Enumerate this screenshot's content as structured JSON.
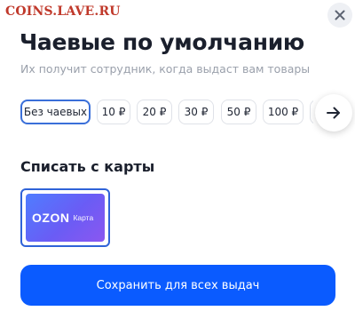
{
  "watermark": "COINS.LAVE.RU",
  "modal": {
    "title": "Чаевые по умолчанию",
    "subtitle": "Их получит сотрудник, когда выдаст вам товары"
  },
  "tips": {
    "options": [
      "Без чаевых",
      "10 ₽",
      "20 ₽",
      "30 ₽",
      "50 ₽",
      "100 ₽"
    ],
    "selected": "Без чаевых"
  },
  "payment": {
    "section_title": "Списать с карты",
    "card_brand": "OZON",
    "card_label": "Карта"
  },
  "save_button": "Сохранить для всех выдач",
  "colors": {
    "accent": "#0a5bff",
    "selected_border": "#3a6fd9",
    "card_gradient_start": "#4f7dff",
    "card_gradient_end": "#8b57f0"
  },
  "icons": {
    "close": "close-icon",
    "next": "arrow-right-icon"
  }
}
